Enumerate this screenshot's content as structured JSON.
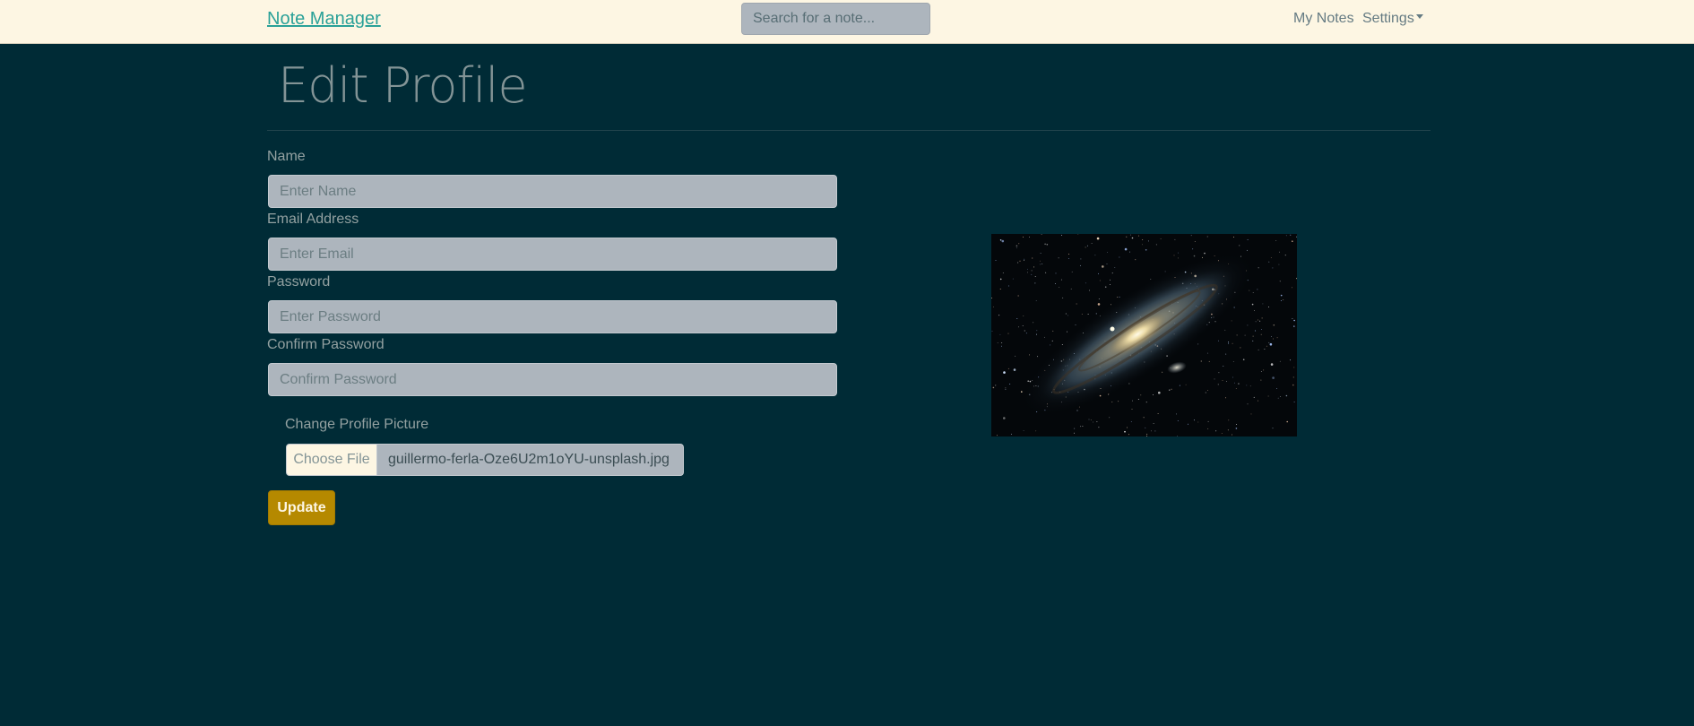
{
  "navbar": {
    "brand": "Note Manager",
    "search_placeholder": "Search for a note...",
    "links": {
      "my_notes": "My Notes",
      "settings": "Settings"
    }
  },
  "page": {
    "title": "Edit Profile"
  },
  "form": {
    "name": {
      "label": "Name",
      "placeholder": "Enter Name"
    },
    "email": {
      "label": "Email Address",
      "placeholder": "Enter Email"
    },
    "password": {
      "label": "Password",
      "placeholder": "Enter Password"
    },
    "confirm_password": {
      "label": "Confirm Password",
      "placeholder": "Confirm Password"
    },
    "picture": {
      "label": "Change Profile Picture",
      "button": "Choose File",
      "filename": "guillermo-ferla-Oze6U2m1oYU-unsplash.jpg"
    },
    "submit": "Update"
  },
  "colors": {
    "background": "#002b36",
    "navbar": "#fdf6e3",
    "brand": "#2aa198",
    "button": "#b58900"
  }
}
